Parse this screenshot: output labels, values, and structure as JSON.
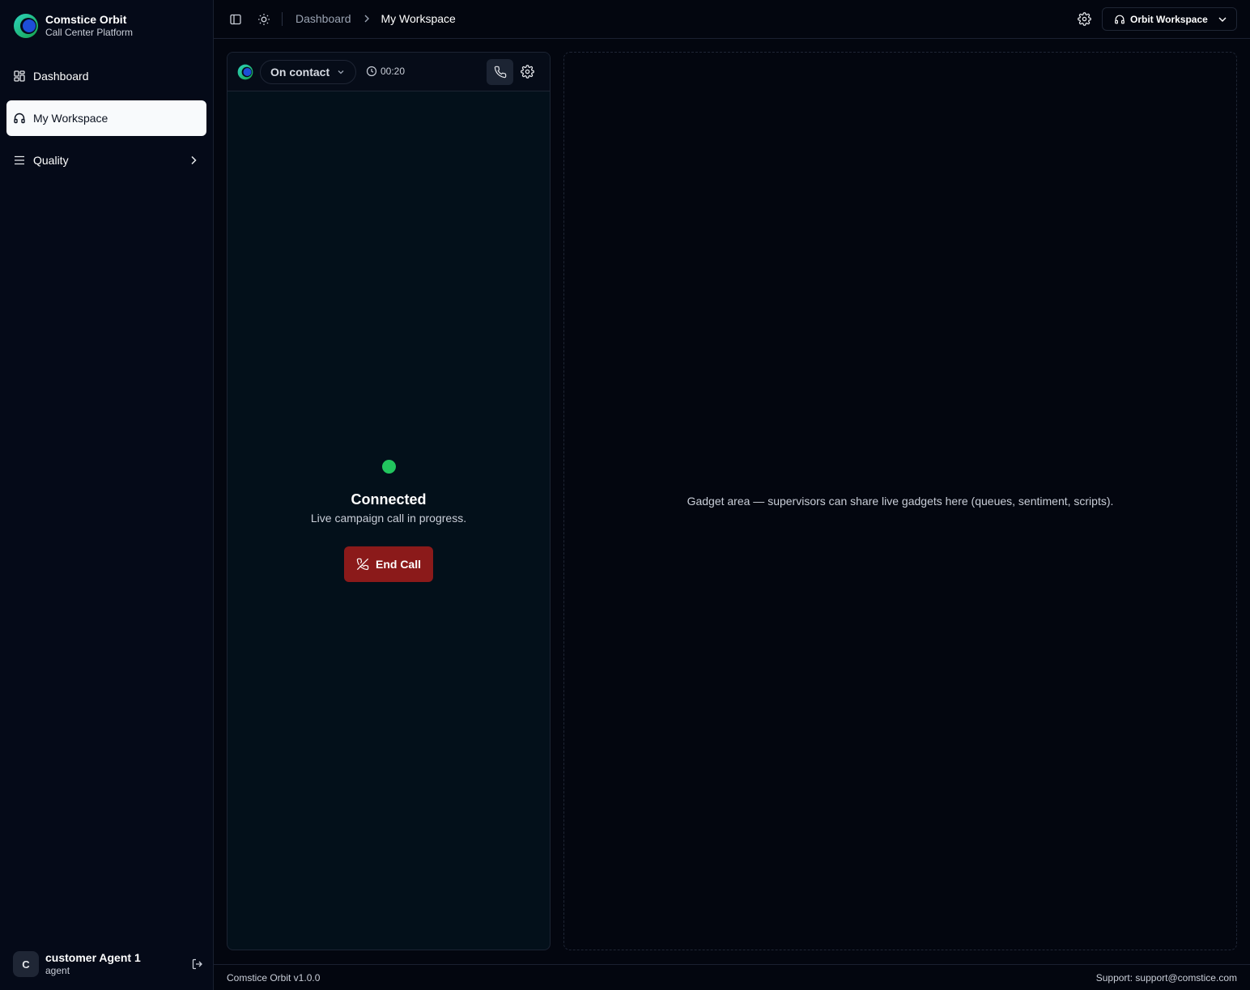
{
  "brand": {
    "title": "Comstice Orbit",
    "subtitle": "Call Center Platform"
  },
  "sidebar": {
    "items": [
      {
        "label": "Dashboard",
        "icon": "dashboard-grid-icon",
        "active": false
      },
      {
        "label": "My Workspace",
        "icon": "headset-icon",
        "active": true
      },
      {
        "label": "Quality",
        "icon": "menu-lines-icon",
        "active": false,
        "has_submenu": true
      }
    ]
  },
  "user": {
    "initial": "C",
    "name": "customer Agent 1",
    "role": "agent"
  },
  "topbar": {
    "breadcrumb": [
      "Dashboard",
      "My Workspace"
    ],
    "workspace_button": "Orbit Workspace"
  },
  "call_panel": {
    "status": "On contact",
    "timer": "00:20",
    "state_title": "Connected",
    "state_subtitle": "Live campaign call in progress.",
    "end_call_label": "End Call",
    "status_color": "#22c55e",
    "end_call_color": "#8b1a1a"
  },
  "gadget_area": {
    "message": "Gadget area — supervisors can share live gadgets here (queues, sentiment, scripts)."
  },
  "footer": {
    "version": "Comstice Orbit v1.0.0",
    "support": "Support: support@comstice.com"
  }
}
